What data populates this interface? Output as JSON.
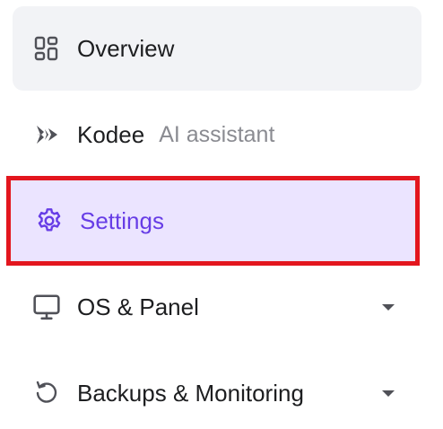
{
  "sidebar": {
    "items": [
      {
        "id": "overview",
        "label": "Overview",
        "icon": "overview-grid-icon",
        "active": false,
        "expandable": false
      },
      {
        "id": "kodee",
        "label": "Kodee",
        "sublabel": "AI assistant",
        "icon": "kodee-sparkle-icon",
        "active": false,
        "expandable": false
      },
      {
        "id": "settings",
        "label": "Settings",
        "icon": "gear-icon",
        "active": true,
        "highlighted": true,
        "expandable": false
      },
      {
        "id": "os-panel",
        "label": "OS & Panel",
        "icon": "monitor-icon",
        "active": false,
        "expandable": true
      },
      {
        "id": "backups",
        "label": "Backups & Monitoring",
        "icon": "restore-icon",
        "active": false,
        "expandable": true
      }
    ]
  },
  "colors": {
    "hover_bg": "#f2f3f6",
    "active_bg": "#ebe4ff",
    "active_text": "#673de6",
    "text": "#1d1e20",
    "muted_text": "#8a8b91",
    "highlight_border": "#e3161e"
  }
}
